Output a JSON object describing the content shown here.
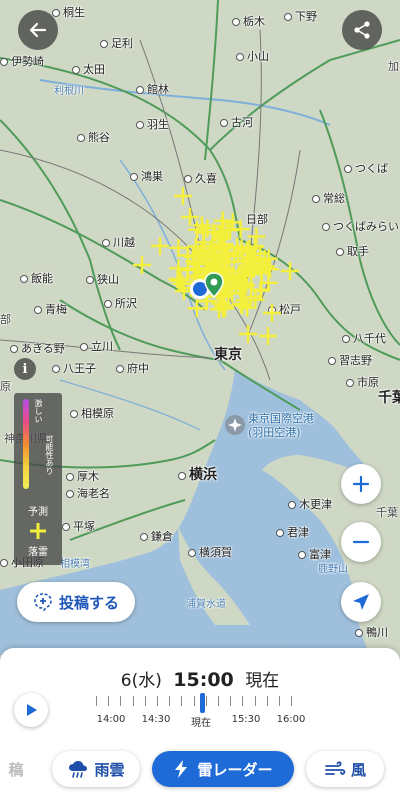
{
  "colors": {
    "accent": "#1e6bd8",
    "lightning": "#f3ef3a",
    "water": "#9fc0dc",
    "land": "#cfd8c4"
  },
  "map": {
    "places": [
      {
        "name": "桐生",
        "dot": true
      },
      {
        "name": "栃木",
        "dot": true
      },
      {
        "name": "下野",
        "dot": true
      },
      {
        "name": "伊勢崎",
        "dot": true
      },
      {
        "name": "足利",
        "dot": true
      },
      {
        "name": "小山",
        "dot": true
      },
      {
        "name": "太田",
        "dot": true
      },
      {
        "name": "利根川",
        "river": true
      },
      {
        "name": "館林",
        "dot": true
      },
      {
        "name": "羽生",
        "dot": true
      },
      {
        "name": "古河",
        "dot": true
      },
      {
        "name": "熊谷",
        "dot": true
      },
      {
        "name": "鴻巣",
        "dot": true
      },
      {
        "name": "久喜",
        "dot": true
      },
      {
        "name": "つくば",
        "dot": true
      },
      {
        "name": "常総",
        "dot": true
      },
      {
        "name": "日部",
        "dot": false
      },
      {
        "name": "つくばみらい",
        "dot": true
      },
      {
        "name": "川越",
        "dot": true
      },
      {
        "name": "取手",
        "dot": true
      },
      {
        "name": "飯能",
        "dot": true
      },
      {
        "name": "狭山",
        "dot": true
      },
      {
        "name": "所沢",
        "dot": true
      },
      {
        "name": "青梅",
        "dot": true
      },
      {
        "name": "松戸",
        "dot": true
      },
      {
        "name": "八千代",
        "dot": true
      },
      {
        "name": "あきる野",
        "dot": true
      },
      {
        "name": "立川",
        "dot": true
      },
      {
        "name": "東京",
        "big": true
      },
      {
        "name": "習志野",
        "dot": true
      },
      {
        "name": "八王子",
        "dot": true
      },
      {
        "name": "府中",
        "dot": true
      },
      {
        "name": "市原",
        "dot": true
      },
      {
        "name": "相模原",
        "dot": true
      },
      {
        "name": "東京国際空港",
        "blue": true
      },
      {
        "name": "(羽田空港)",
        "blue": true
      },
      {
        "name": "千葉",
        "big": true
      },
      {
        "name": "神奈川県",
        "dim": true
      },
      {
        "name": "厚木",
        "dot": true
      },
      {
        "name": "横浜",
        "big": true
      },
      {
        "name": "海老名",
        "dot": true
      },
      {
        "name": "木更津",
        "dot": true
      },
      {
        "name": "平塚",
        "dot": true
      },
      {
        "name": "君津",
        "dot": true
      },
      {
        "name": "鎌倉",
        "dot": true
      },
      {
        "name": "横須賀",
        "dot": true
      },
      {
        "name": "小田原",
        "dot": true
      },
      {
        "name": "相模湾",
        "river": true
      },
      {
        "name": "富津",
        "dot": true
      },
      {
        "name": "鹿野山",
        "river": true
      },
      {
        "name": "浦賀水道",
        "river": true
      },
      {
        "name": "鴨川",
        "dot": true
      },
      {
        "name": "加",
        "dim": true
      },
      {
        "name": "部",
        "dim": true
      },
      {
        "name": "原",
        "dim": true
      },
      {
        "name": "千葉",
        "dim": true
      }
    ]
  },
  "legend": {
    "top_label": "激しい",
    "forecast_note": "可能性あり",
    "forecast_label": "予測",
    "strike_label": "落雷"
  },
  "post_button": {
    "label": "投稿する"
  },
  "timeline": {
    "day": "6(水)",
    "time": "15:00",
    "status": "現在",
    "labels": [
      "14:00",
      "14:30",
      "現在",
      "15:30",
      "16:00"
    ],
    "position": 0.5
  },
  "tabs": [
    {
      "label": "稿",
      "icon": "partial-tab",
      "active": false
    },
    {
      "label": "雨雲",
      "icon": "rain-cloud-icon",
      "active": false
    },
    {
      "label": "雷レーダー",
      "icon": "lightning-icon",
      "active": true
    },
    {
      "label": "風",
      "icon": "wind-icon",
      "active": false
    }
  ]
}
